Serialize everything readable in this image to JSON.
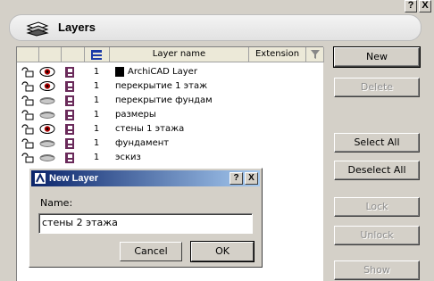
{
  "window": {
    "title": "Layers",
    "title_buttons": [
      "?",
      "X"
    ]
  },
  "columns": {
    "layer_name": "Layer name",
    "extension": "Extension"
  },
  "layers": [
    {
      "num": "1",
      "name": "ArchiCAD Layer",
      "visible": true,
      "has_icon": true
    },
    {
      "num": "1",
      "name": "перекрытие 1 этаж",
      "visible": true,
      "has_icon": false
    },
    {
      "num": "1",
      "name": "перекрытие фундам",
      "visible": false,
      "has_icon": false
    },
    {
      "num": "1",
      "name": "размеры",
      "visible": false,
      "has_icon": false
    },
    {
      "num": "1",
      "name": "стены 1 этажа",
      "visible": true,
      "has_icon": false
    },
    {
      "num": "1",
      "name": "фундамент",
      "visible": false,
      "has_icon": false
    },
    {
      "num": "1",
      "name": "эскиз",
      "visible": false,
      "has_icon": false
    }
  ],
  "side_buttons": {
    "new": "New",
    "delete": "Delete",
    "select_all": "Select All",
    "deselect_all": "Deselect All",
    "lock": "Lock",
    "unlock": "Unlock",
    "show": "Show"
  },
  "dialog": {
    "title": "New Layer",
    "help": "?",
    "close": "X",
    "name_label": "Name:",
    "name_value": "стены 2 этажа",
    "cancel": "Cancel",
    "ok": "OK"
  },
  "colors": {
    "dialog_title": "#0a246a",
    "layer_icon": "#6a2a5a",
    "eye_red": "#b00000"
  }
}
